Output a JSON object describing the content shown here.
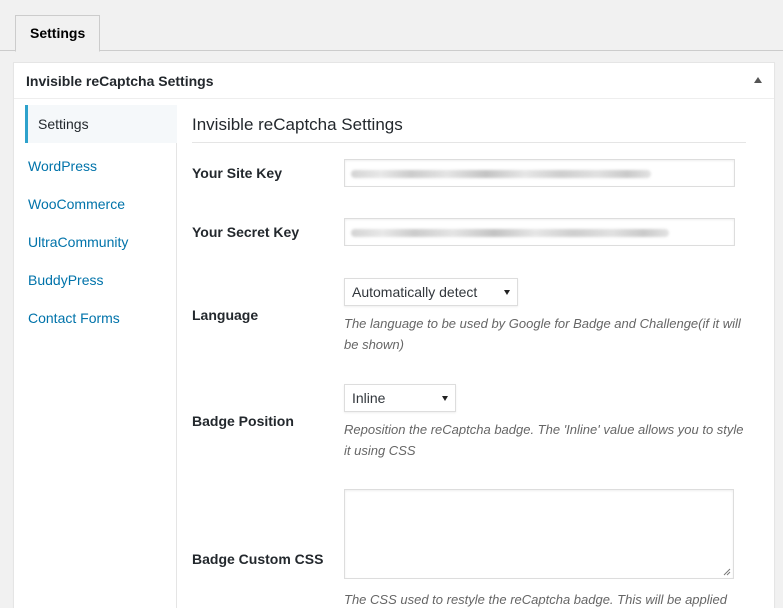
{
  "tabs": [
    {
      "label": "Settings"
    }
  ],
  "postbox": {
    "title": "Invisible reCaptcha Settings"
  },
  "sidebar": {
    "items": [
      {
        "label": "Settings",
        "active": true
      },
      {
        "label": "WordPress"
      },
      {
        "label": "WooCommerce"
      },
      {
        "label": "UltraCommunity"
      },
      {
        "label": "BuddyPress"
      },
      {
        "label": "Contact Forms"
      }
    ]
  },
  "main": {
    "section_title": "Invisible reCaptcha Settings",
    "fields": {
      "site_key": {
        "label": "Your Site Key"
      },
      "secret_key": {
        "label": "Your Secret Key"
      },
      "language": {
        "label": "Language",
        "value": "Automatically detect",
        "description": "The language to be used by Google for Badge and Challenge(if it will be shown)"
      },
      "badge_position": {
        "label": "Badge Position",
        "value": "Inline",
        "description": "Reposition the reCaptcha badge. The 'Inline' value allows you to style it using CSS"
      },
      "badge_css": {
        "label": "Badge Custom CSS",
        "value": "",
        "description": "The CSS used to restyle the reCaptcha badge. This will be applied"
      }
    }
  },
  "colors": {
    "link": "#0073aa",
    "accent": "#2ea2cc",
    "text": "#23282d",
    "muted": "#666666"
  },
  "icons": {
    "collapse": "triangle-up-icon",
    "dropdown": "chevron-down-icon",
    "resize": "resize-handle-icon"
  }
}
